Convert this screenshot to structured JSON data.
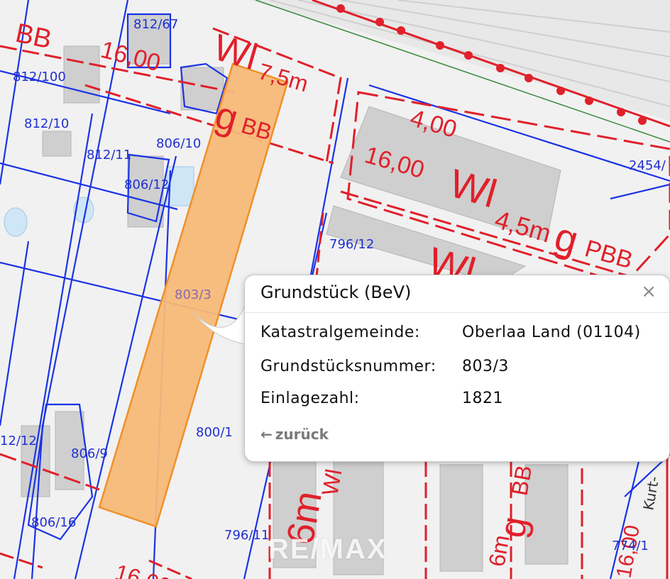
{
  "map": {
    "parcels": [
      "812/67",
      "812/100",
      "812/10",
      "812/11",
      "806/10",
      "806/12",
      "796/12",
      "803/3",
      "800/1",
      "806/9",
      "12/12",
      "806/16",
      "796/11",
      "774/1",
      "2454/"
    ],
    "zoning": [
      "16,00",
      "Wl",
      "7,5m",
      "g",
      "BB",
      "4,00",
      "16,00",
      "Wl",
      "4,5m",
      "g",
      "PBB",
      "Wl",
      "6m",
      "Wl",
      "6m",
      "g",
      "BB",
      "BB",
      "16,00"
    ],
    "street_name": "Kurt-",
    "highlight_color": "#f6b978",
    "highlight_border": "#f0902a",
    "line_blue": "#1a33e6",
    "line_red": "#e0202a"
  },
  "popup": {
    "title": "Grundstück (BeV)",
    "close_label": "×",
    "rows": [
      {
        "label": "Katastralgemeinde:",
        "value": "Oberlaa Land (01104)"
      },
      {
        "label": "Grundstücksnummer:",
        "value": "803/3"
      },
      {
        "label": "Einlagezahl:",
        "value": "1821"
      }
    ],
    "back_arrow": "←",
    "back_label": "zurück"
  },
  "watermark": "RE/MAX"
}
